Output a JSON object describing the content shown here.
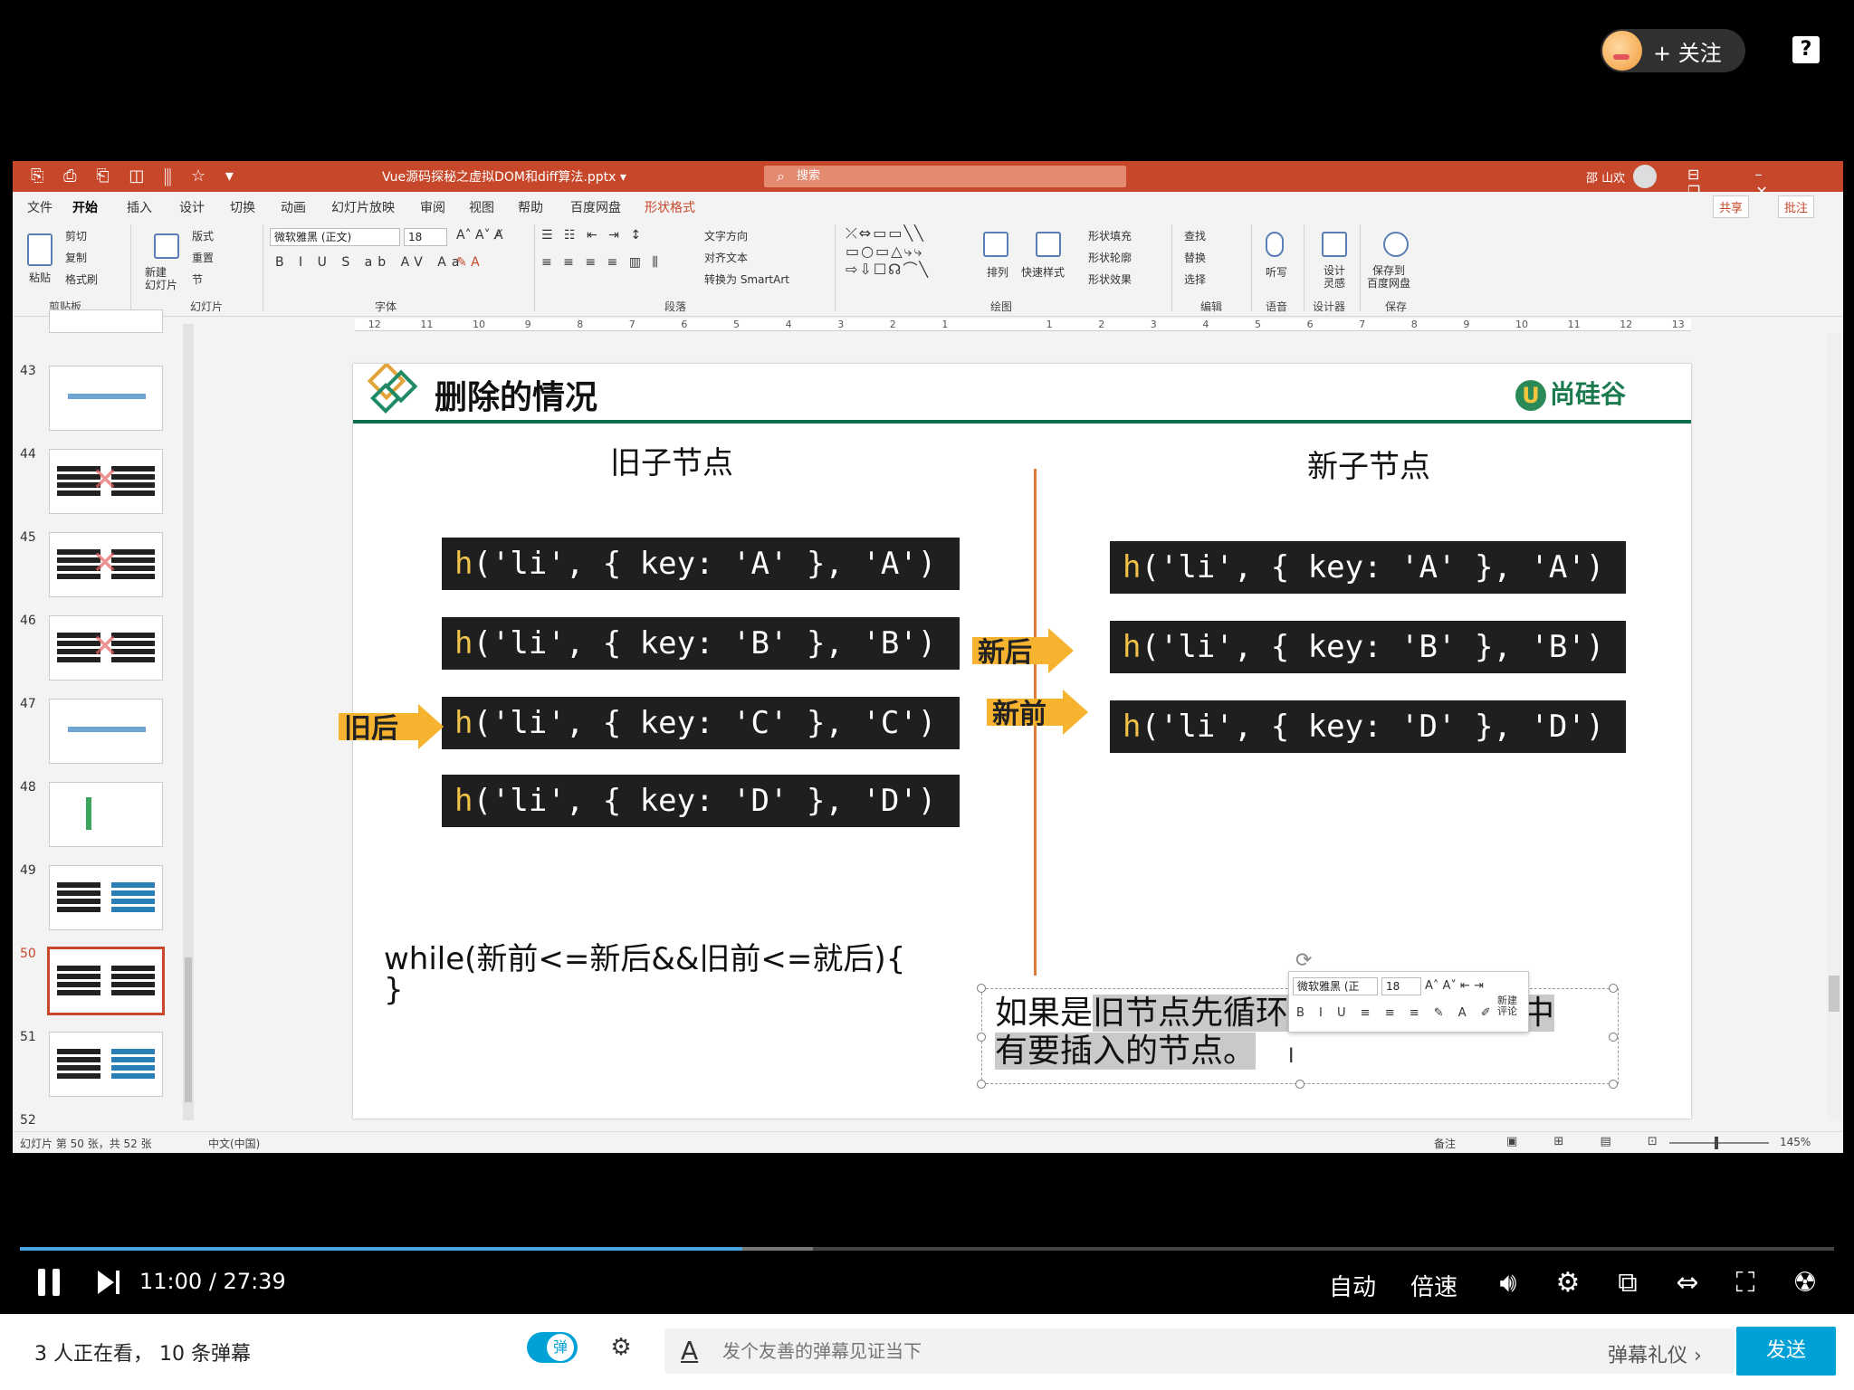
{
  "overlay": {
    "follow_label": "+ 关注",
    "help": "?"
  },
  "ppt": {
    "doc_title": "Vue源码探秘之虚拟DOM和diff算法.pptx ▾",
    "search_placeholder": "搜索",
    "user": "邵 山欢",
    "menu": [
      "文件",
      "开始",
      "插入",
      "设计",
      "切换",
      "动画",
      "幻灯片放映",
      "审阅",
      "视图",
      "帮助",
      "百度网盘",
      "形状格式"
    ],
    "share": "共享",
    "comment": "批注",
    "ribbon": {
      "groups": [
        "剪贴板",
        "幻灯片",
        "字体",
        "段落",
        "绘图",
        "编辑",
        "语音",
        "设计器",
        "保存"
      ],
      "paste": "粘贴",
      "cut": "剪切",
      "copy": "复制",
      "format_painter": "格式刷",
      "new_slide": "新建\n幻灯片",
      "layout": "版式",
      "reset": "重置",
      "section": "节",
      "font_name": "微软雅黑 (正文)",
      "font_size": "18",
      "text_direction": "文字方向",
      "align_text": "对齐文本",
      "smartart": "转换为 SmartArt",
      "arrange": "排列",
      "quick_styles": "快速样式",
      "shape_fill": "形状填充",
      "shape_outline": "形状轮廓",
      "shape_effects": "形状效果",
      "find": "查找",
      "replace": "替换",
      "select": "选择",
      "dictate": "听写",
      "design_ideas": "设计\n灵感",
      "save_baidu": "保存到\n百度网盘"
    },
    "thumbnails": [
      "43",
      "44",
      "45",
      "46",
      "47",
      "48",
      "49",
      "50",
      "51",
      "52"
    ],
    "selected_slide": "50",
    "ruler_left": [
      "12",
      "11",
      "10",
      "9",
      "8",
      "7",
      "6",
      "5",
      "4",
      "3",
      "2",
      "1"
    ],
    "ruler_right": [
      "1",
      "2",
      "3",
      "4",
      "5",
      "6",
      "7",
      "8",
      "9",
      "10",
      "11",
      "12",
      "13"
    ],
    "slide": {
      "title": "删除的情况",
      "brand": "尚硅谷",
      "old_head": "旧子节点",
      "new_head": "新子节点",
      "old_nodes": [
        "h('li', { key: 'A' }, 'A')",
        "h('li', { key: 'B' }, 'B')",
        "h('li', { key: 'C' }, 'C')",
        "h('li', { key: 'D' }, 'D')"
      ],
      "new_nodes": [
        "h('li', { key: 'A' }, 'A')",
        "h('li', { key: 'B' }, 'B')",
        "h('li', { key: 'D' }, 'D')"
      ],
      "arrow_old_after": "旧后",
      "arrow_new_after": "新后",
      "arrow_new_before": "新前",
      "while_line": "while(新前<=新后&&旧前<=就后){",
      "brace": "}",
      "textbox_pre": "如果是",
      "textbox_hl1": "旧节点先循环",
      "textbox_hl2": "点中",
      "textbox_line2": "有要插入的节点。",
      "mini_font": "微软雅黑 (正",
      "mini_size": "18",
      "mini_new_comment": "新建\n评论"
    },
    "status": {
      "slide_info": "幻灯片 第 50 张，共 52 张",
      "language": "中文(中国)",
      "notes": "备注",
      "zoom": "145%"
    }
  },
  "player": {
    "current_time": "11:00",
    "separator": "/",
    "total_time": "27:39",
    "progress_fraction": 0.398,
    "auto": "自动",
    "speed": "倍速"
  },
  "bottom": {
    "viewers": "3 人正在看， 10 条弹幕",
    "toggle_label": "弹",
    "input_placeholder": "发个友善的弹幕见证当下",
    "etiquette": "弹幕礼仪 ›",
    "send": "发送"
  }
}
